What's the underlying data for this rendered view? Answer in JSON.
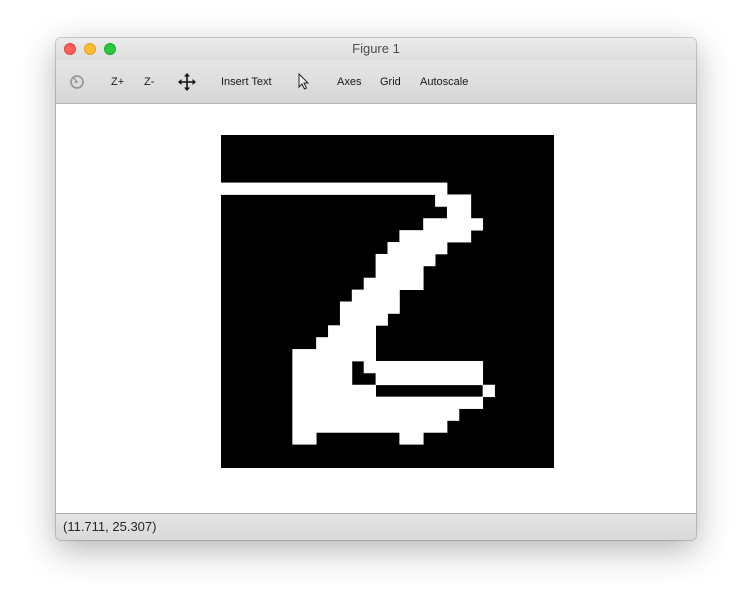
{
  "window": {
    "title": "Figure 1"
  },
  "toolbar": {
    "home_icon": "home-icon",
    "zoom_in_label": "Z+",
    "zoom_out_label": "Z-",
    "pan_icon": "move-arrows-icon",
    "insert_text_label": "Insert Text",
    "select_icon": "pointer-arrow-icon",
    "axes_label": "Axes",
    "grid_label": "Grid",
    "autoscale_label": "Autoscale"
  },
  "figure": {
    "image_size": [
      28,
      28
    ],
    "colors": {
      "background": "#000000",
      "foreground": "#ffffff"
    },
    "rows": [
      "............................",
      "............................",
      "............................",
      "............................",
      "===================.........",
      "..................===.......",
      "...................==.......",
      ".................=====......",
      "...............======.......",
      "..............=====.........",
      ".............=====..........",
      ".............====...........",
      "............=====...........",
      "...........====.............",
      "..........=====.............",
      "..........====..............",
      ".........====...............",
      "........=====...............",
      "......=======...............",
      "......=====.==========......",
      "......=====..=========......",
      "......=======.........=.....",
      "......================......",
      "......==============........",
      "......=============.........",
      "......==.......==...........",
      "............................",
      "............................"
    ]
  },
  "status": {
    "coords": "(11.711, 25.307)"
  }
}
